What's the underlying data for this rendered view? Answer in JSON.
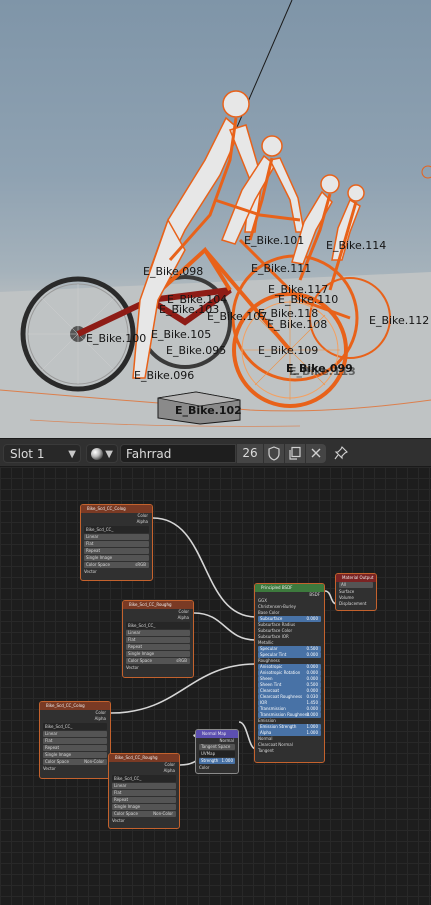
{
  "viewport": {
    "objects": [
      {
        "label": "E_Bike.101"
      },
      {
        "label": "E_Bike.114"
      },
      {
        "label": "E_Bike.098"
      },
      {
        "label": "E_Bike.111"
      },
      {
        "label": "E_Bike.117"
      },
      {
        "label": "E_Bike.110"
      },
      {
        "label": "E_Bike.104"
      },
      {
        "label": "E_Bike.103"
      },
      {
        "label": "E_Bike.107"
      },
      {
        "label": "E_Bike.118"
      },
      {
        "label": "E_Bike.112"
      },
      {
        "label": "E_Bike.108"
      },
      {
        "label": "E_Bike.105"
      },
      {
        "label": "E_Bike.100"
      },
      {
        "label": "E_Bike.095"
      },
      {
        "label": "E_Bike.109"
      },
      {
        "label": "E_Bike.099"
      },
      {
        "label": "E_Bike.113"
      },
      {
        "label": "E_Bike.096"
      },
      {
        "label": "E_Bike.102"
      }
    ]
  },
  "header": {
    "slot": "Slot 1",
    "material_name": "Fahrrad",
    "user_count": "26",
    "icons": [
      "material-ball-icon",
      "fake-user-shield-icon",
      "duplicate-icon",
      "unlink-x-icon",
      "pin-icon"
    ]
  },
  "nodes": {
    "tex1": {
      "title": "Bike_Scd_CC_Colog",
      "out1": "Color",
      "out2": "Alpha",
      "img": "Bike_Scd_CC_",
      "opt1": "Linear",
      "opt2": "Flat",
      "opt3": "Repeat",
      "opt4": "Single Image",
      "opt5": "Color Space",
      "opt5v": "sRGB",
      "in1": "Vector"
    },
    "tex2": {
      "title": "Bike_Scd_CC_Roughg",
      "out1": "Color",
      "out2": "Alpha",
      "img": "Bike_Scd_CC_",
      "opt1": "Linear",
      "opt2": "Flat",
      "opt3": "Repeat",
      "opt4": "Single Image",
      "opt5": "Color Space",
      "opt5v": "sRGB",
      "in1": "Vector"
    },
    "tex3": {
      "title": "Bike_Scd_CC_Colog",
      "out1": "Color",
      "out2": "Alpha",
      "img": "Bike_Scd_CC_",
      "opt1": "Linear",
      "opt2": "Flat",
      "opt3": "Repeat",
      "opt4": "Single Image",
      "opt5": "Color Space",
      "opt5v": "Non-Color",
      "in1": "Vector"
    },
    "tex4": {
      "title": "Bike_Scd_CC_Roughg",
      "out1": "Color",
      "out2": "Alpha",
      "img": "Bike_Scd_CC_",
      "opt1": "Linear",
      "opt2": "Flat",
      "opt3": "Repeat",
      "opt4": "Single Image",
      "opt5": "Color Space",
      "opt5v": "Non-Color",
      "in1": "Vector"
    },
    "bump": {
      "title": "Normal Map",
      "out1": "Normal",
      "opt1": "Tangent Space",
      "field1": "UVMap",
      "field2": "Strength",
      "field2v": "1.000",
      "in1": "Color"
    },
    "bsdf": {
      "title": "Principled BSDF",
      "out1": "BSDF",
      "rows": [
        {
          "label": "GGX",
          "value": ""
        },
        {
          "label": "Christensen-Burley",
          "value": ""
        },
        {
          "label": "Base Color",
          "value": ""
        },
        {
          "label": "Subsurface",
          "value": "0.000"
        },
        {
          "label": "Subsurface Radius",
          "value": ""
        },
        {
          "label": "Subsurface Color",
          "value": ""
        },
        {
          "label": "Subsurface IOR",
          "value": ""
        },
        {
          "label": "Metallic",
          "value": ""
        },
        {
          "label": "Specular",
          "value": "0.500"
        },
        {
          "label": "Specular Tint",
          "value": "0.000"
        },
        {
          "label": "Roughness",
          "value": ""
        },
        {
          "label": "Anisotropic",
          "value": "0.000"
        },
        {
          "label": "Anisotropic Rotation",
          "value": "0.000"
        },
        {
          "label": "Sheen",
          "value": "0.000"
        },
        {
          "label": "Sheen Tint",
          "value": "0.500"
        },
        {
          "label": "Clearcoat",
          "value": "0.000"
        },
        {
          "label": "Clearcoat Roughness",
          "value": "0.030"
        },
        {
          "label": "IOR",
          "value": "1.450"
        },
        {
          "label": "Transmission",
          "value": "0.000"
        },
        {
          "label": "Transmission Roughness",
          "value": "0.000"
        },
        {
          "label": "Emission",
          "value": ""
        },
        {
          "label": "Emission Strength",
          "value": "1.000"
        },
        {
          "label": "Alpha",
          "value": "1.000"
        },
        {
          "label": "Normal",
          "value": ""
        },
        {
          "label": "Clearcoat Normal",
          "value": ""
        },
        {
          "label": "Tangent",
          "value": ""
        }
      ]
    },
    "output": {
      "title": "Material Output",
      "field1": "All",
      "in1": "Surface",
      "in2": "Volume",
      "in3": "Displacement"
    }
  },
  "colors": {
    "selection_orange": "#e8621a",
    "node_border": "#c4622d",
    "bsdf_header": "#3d7a3d",
    "output_header": "#7b2323",
    "normal_map_header": "#5c4fb0",
    "texture_header": "#7a3a24"
  }
}
